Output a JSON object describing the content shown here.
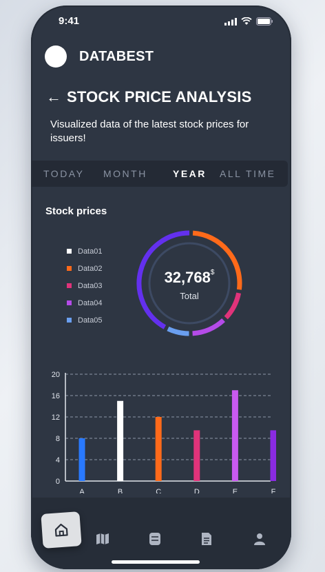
{
  "status": {
    "time": "9:41"
  },
  "app": {
    "brand": "DATABEST"
  },
  "header": {
    "title": "STOCK PRICE ANALYSIS",
    "subtitle": "Visualized data of the latest stock prices for issuers!"
  },
  "tabs": [
    {
      "label": "TODAY",
      "active": false
    },
    {
      "label": "MONTH",
      "active": false
    },
    {
      "label": "YEAR",
      "active": true
    },
    {
      "label": "ALL TIME",
      "active": false
    }
  ],
  "section": {
    "title": "Stock prices"
  },
  "icons": [
    "signal-icon",
    "wifi-icon",
    "battery-icon",
    "back-arrow-icon",
    "home-icon",
    "map-icon",
    "database-icon",
    "document-icon",
    "user-icon"
  ],
  "chart_data": [
    {
      "type": "pie",
      "series": [
        {
          "name": "Data01",
          "color": "#ffffff"
        },
        {
          "name": "Data02",
          "color": "#ff6a1a",
          "value": 27
        },
        {
          "name": "Data03",
          "color": "#e0337a",
          "value": 10
        },
        {
          "name": "Data04",
          "color": "#b44be8",
          "value": 12
        },
        {
          "name": "Data05",
          "color": "#6a9ff0",
          "value": 8
        },
        {
          "name": "",
          "color": "#6330ee",
          "value": 43
        }
      ],
      "total": {
        "value": "32,768",
        "unit": "$",
        "label": "Total"
      }
    },
    {
      "type": "bar",
      "categories": [
        "A",
        "B",
        "C",
        "D",
        "E",
        "F"
      ],
      "values": [
        8,
        15,
        12,
        9.5,
        17,
        9.5
      ],
      "colors": [
        "#2979ff",
        "#ffffff",
        "#ff6a1a",
        "#e0337a",
        "#c85af0",
        "#8a2be2"
      ],
      "ylim": [
        0,
        20
      ],
      "yticks": [
        0,
        4,
        8,
        12,
        16,
        20
      ],
      "grid": true
    }
  ]
}
